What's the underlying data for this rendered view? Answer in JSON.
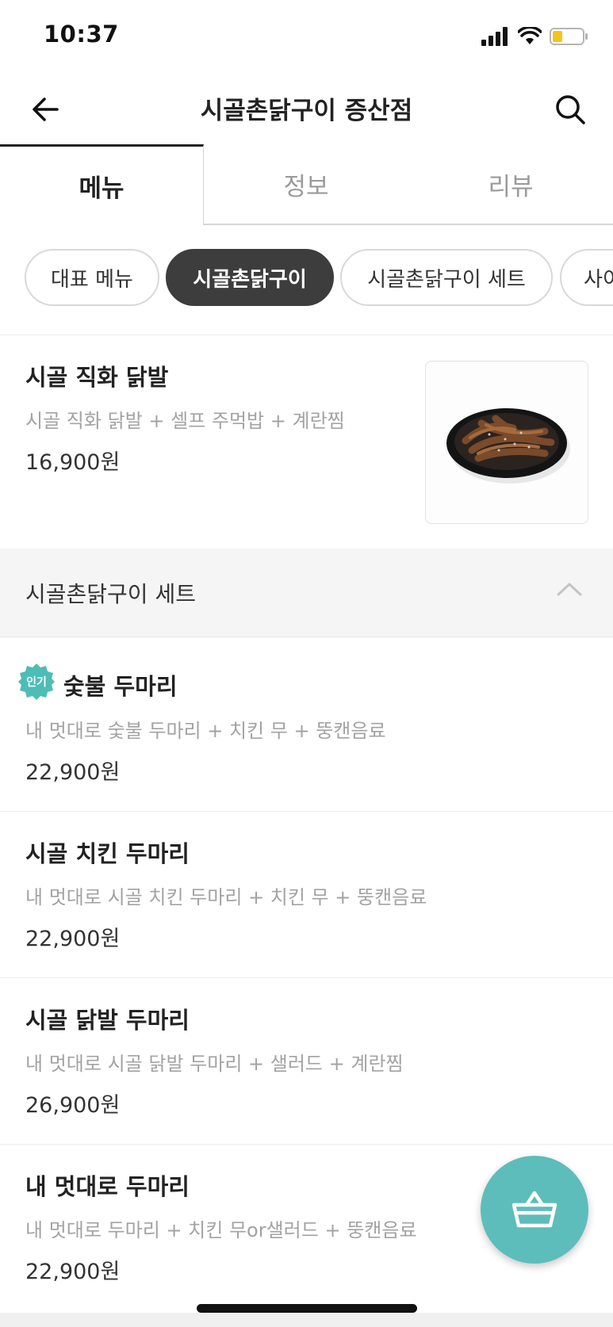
{
  "status_bar": {
    "time": "10:37"
  },
  "header": {
    "title": "시골촌닭구이 증산점",
    "back_icon": "arrow-left-icon",
    "search_icon": "search-icon"
  },
  "tabs": [
    {
      "label": "메뉴",
      "active": true
    },
    {
      "label": "정보",
      "active": false
    },
    {
      "label": "리뷰",
      "active": false
    }
  ],
  "categories": [
    {
      "label": "대표 메뉴",
      "active": false
    },
    {
      "label": "시골촌닭구이",
      "active": true
    },
    {
      "label": "시골촌닭구이 세트",
      "active": false
    },
    {
      "label": "사이",
      "active": false
    }
  ],
  "featured_item": {
    "name": "시골 직화 닭발",
    "desc": "시골 직화 닭발 + 셀프 주먹밥 + 계란찜",
    "price": "16,900원"
  },
  "section": {
    "title": "시골촌닭구이 세트",
    "icon": "chevron-up-icon"
  },
  "set_items": [
    {
      "badge": "인기",
      "name": "숯불 두마리",
      "desc": "내 멋대로 숯불 두마리 + 치킨 무 + 뚱캔음료",
      "price": "22,900원"
    },
    {
      "name": "시골 치킨 두마리",
      "desc": "내 멋대로 시골 치킨 두마리 + 치킨 무 + 뚱캔음료",
      "price": "22,900원"
    },
    {
      "name": "시골 닭발 두마리",
      "desc": "내 멋대로 시골 닭발 두마리 + 샐러드 + 계란찜",
      "price": "26,900원"
    },
    {
      "name": "내 멋대로 두마리",
      "desc": "내 멋대로 두마리 + 치킨 무or샐러드 + 뚱캔음료",
      "price": "22,900원"
    }
  ],
  "cart": {
    "icon": "basket-icon"
  },
  "colors": {
    "accent": "#5dbdba",
    "chip_active": "#3d3d3d",
    "text_muted": "#a3a3a3"
  }
}
